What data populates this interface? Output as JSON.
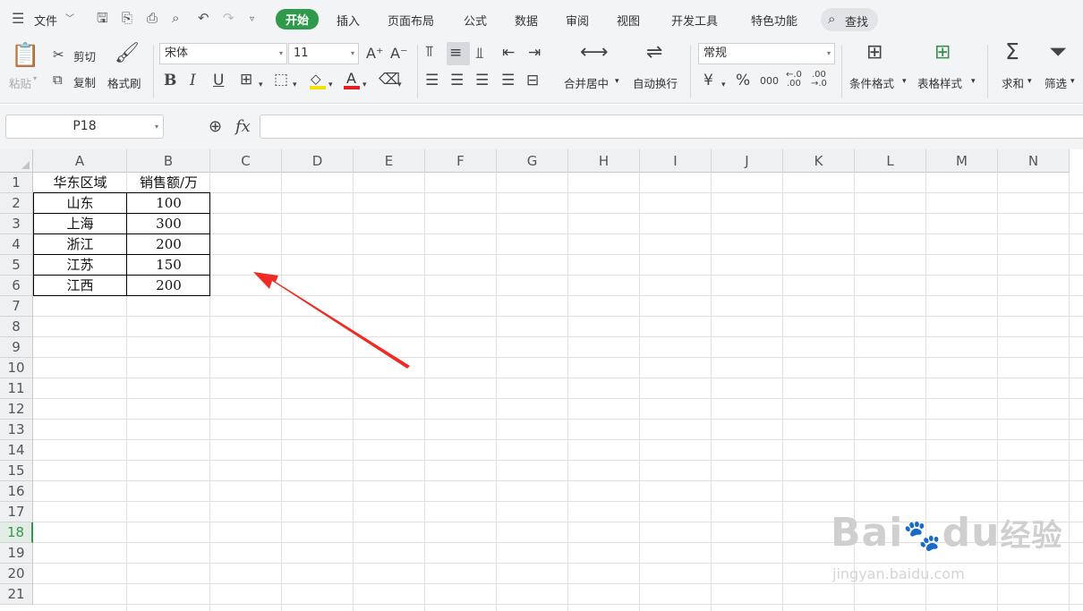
{
  "menubar": {
    "file": "文件",
    "tabs": [
      "开始",
      "插入",
      "页面布局",
      "公式",
      "数据",
      "审阅",
      "视图",
      "开发工具",
      "特色功能"
    ],
    "search": "查找"
  },
  "ribbon": {
    "paste": "粘贴",
    "cut": "剪切",
    "copy": "复制",
    "format_painter": "格式刷",
    "font_name": "宋体",
    "font_size": "11",
    "merge_center": "合并居中",
    "wrap_text": "自动换行",
    "number_format": "常规",
    "conditional_format": "条件格式",
    "table_style": "表格样式",
    "sum": "求和",
    "filter": "筛选"
  },
  "formula_bar": {
    "name_box": "P18",
    "fx": "fx"
  },
  "sheet": {
    "columns": [
      "A",
      "B",
      "C",
      "D",
      "E",
      "F",
      "G",
      "H",
      "I",
      "J",
      "K",
      "L",
      "M",
      "N"
    ],
    "rows": [
      "1",
      "2",
      "3",
      "4",
      "5",
      "6",
      "7",
      "8",
      "9",
      "10",
      "11",
      "12",
      "13",
      "14",
      "15",
      "16",
      "17",
      "18",
      "19",
      "20",
      "21"
    ],
    "selected_row": "18",
    "table": {
      "header": [
        "华东区域",
        "销售额/万"
      ],
      "rows": [
        [
          "山东",
          "100"
        ],
        [
          "上海",
          "300"
        ],
        [
          "浙江",
          "200"
        ],
        [
          "江苏",
          "150"
        ],
        [
          "江西",
          "200"
        ]
      ]
    }
  },
  "watermark": {
    "brand": "Bai",
    "brand2": "du",
    "brand3": "经验",
    "url": "jingyan.baidu.com"
  },
  "colors": {
    "accent": "#2f9a4b",
    "arrow": "#ee2b24"
  }
}
